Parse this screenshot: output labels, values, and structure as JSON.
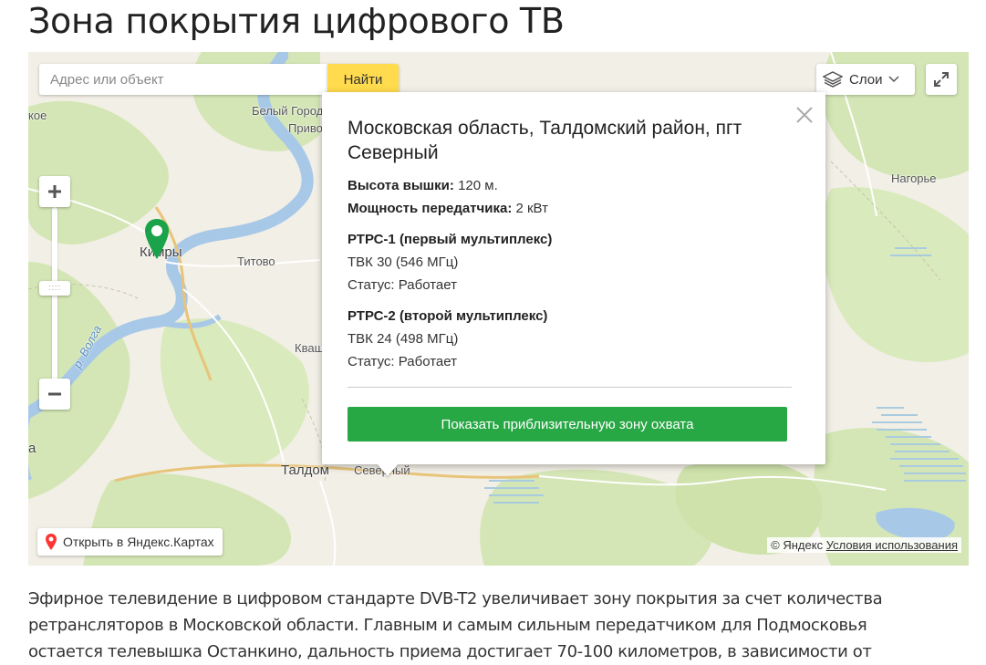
{
  "page": {
    "title": "Зона покрытия цифрового ТВ"
  },
  "map": {
    "search": {
      "placeholder": "Адрес или объект",
      "button_label": "Найти"
    },
    "layers_label": "Слои",
    "places": {
      "koe": "кое",
      "belyi_gorodok": "Белый Город",
      "privolzhskiy": "Приво",
      "kimry": "Кимры",
      "titovo": "Титово",
      "nagorye": "Нагорье",
      "volga": "р. Волга",
      "kvash": "Кваш",
      "taldom": "Талдом",
      "severny": "Северный",
      "edge_a": "а"
    },
    "balloon": {
      "title": "Московская область, Талдомский район, пгт Северный",
      "height_label": "Высота вышки:",
      "height_value": "120 м.",
      "power_label": "Мощность передатчика:",
      "power_value": "2 кВт",
      "mux1": {
        "name": "РТРС-1 (первый мультиплекс)",
        "channel": "ТВК 30 (546 МГц)",
        "status": "Статус: Работает"
      },
      "mux2": {
        "name": "РТРС-2 (второй мультиплекс)",
        "channel": "ТВК 24 (498 МГц)",
        "status": "Статус: Работает"
      },
      "zone_button_label": "Показать приблизительную зону охвата"
    },
    "open_in_maps_label": "Открыть в Яндекс.Картах",
    "copyright": "© Яндекс",
    "terms_label": "Условия использования",
    "colors": {
      "pin": "#1aa34a",
      "button_green": "#28a745",
      "search_yellow": "#ffdb4d",
      "water": "#a8c8e8",
      "forest": "#d4e6b5"
    }
  },
  "article": {
    "text": "Эфирное телевидение в цифровом стандарте DVB-T2 увеличивает зону покрытия за счет количества ретрансляторов в Московской области. Главным и самым сильным передатчиком для Подмосковья остается телевышка Останкино, дальность приема достигает 70-100 километров, в зависимости от"
  }
}
